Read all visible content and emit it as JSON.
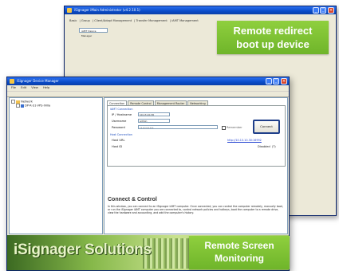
{
  "back_window": {
    "title": "iSignager iMain Administrator (v4.2.10.1)",
    "toolbar_items": [
      "Basic",
      "Group",
      "Client/Adapt Management",
      "Transfer Management",
      "iAMT Management"
    ],
    "field_value": "iAMT Device Manager",
    "controls": {
      "minimize": "_",
      "maximize": "□",
      "close": "×"
    }
  },
  "callouts": {
    "redirect": {
      "line1": "Remote redirect",
      "line2": "boot up device"
    },
    "monitor": {
      "line1": "Remote Screen",
      "line2": "Monitoring"
    }
  },
  "front_window": {
    "title": "iSignager Device Manager",
    "menu": [
      "File",
      "Edit",
      "View",
      "Help"
    ],
    "controls": {
      "minimize": "_",
      "maximize": "□",
      "close": "×"
    },
    "tree": {
      "root": "Network",
      "child": "DP-R-S1-VPS-iVilla"
    },
    "tabs": [
      "Connection",
      "Remote Control",
      "Management Router",
      "Networking"
    ],
    "connection": {
      "section_amt": "iAMT Connection",
      "ip_label": "IP / Hostname",
      "ip_value": "10.13.10.30",
      "user_label": "Username",
      "user_value": "admin",
      "pass_label": "Password",
      "pass_value": "••••••••••",
      "remember_label": "Remember",
      "connect_button": "Connect",
      "section_host": "Host Connection",
      "host_url_label": "Host URL",
      "host_url_value": "http://10.13.10.30:16992",
      "host_id_label": "Host ID",
      "host_id_value": "Disabled",
      "host_id_suffix": "(?)"
    },
    "connect_control": {
      "title": "Connect & Control",
      "text": "In this window, you can connect to an iSignager iAMT computer. Once connected, you can control the computer remotely, manually boot, or run the iSignager iAMT computer you are connected to, control network policies and hotkeys, boot the computer to a remote drive, view the hardware and accounting, and add the computer's history."
    },
    "banner": {
      "title": "iSignager Solutions"
    },
    "status": "iSignager Device Manager - v4.2.1"
  }
}
